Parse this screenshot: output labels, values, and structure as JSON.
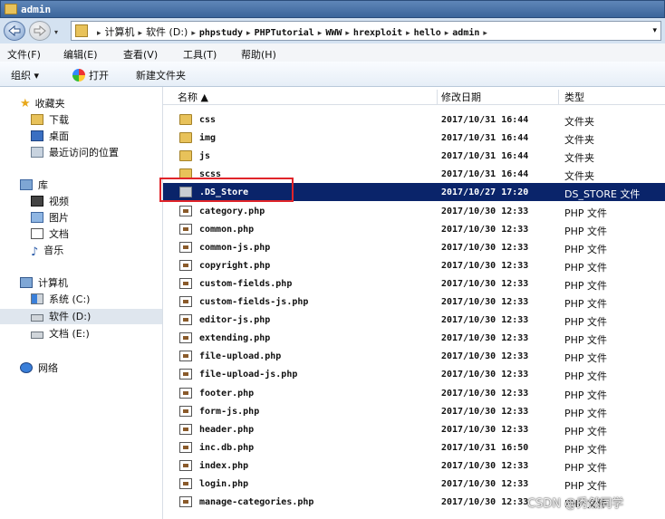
{
  "window": {
    "title": "admin"
  },
  "address": {
    "crumbs": [
      "计算机",
      "软件 (D:)",
      "phpstudy",
      "PHPTutorial",
      "WWW",
      "hrexploit",
      "hello",
      "admin"
    ]
  },
  "menu": [
    "文件(F)",
    "编辑(E)",
    "查看(V)",
    "工具(T)",
    "帮助(H)"
  ],
  "toolbar": {
    "organize": "组织 ▾",
    "open": "打开",
    "new_folder": "新建文件夹"
  },
  "nav": {
    "favorites": {
      "label": "收藏夹",
      "items": [
        "下载",
        "桌面",
        "最近访问的位置"
      ]
    },
    "libraries": {
      "label": "库",
      "items": [
        "视频",
        "图片",
        "文档",
        "音乐"
      ]
    },
    "computer": {
      "label": "计算机",
      "items": [
        "系统 (C:)",
        "软件 (D:)",
        "文档 (E:)"
      ]
    },
    "network": {
      "label": "网络"
    }
  },
  "columns": {
    "name": "名称 ▲",
    "date": "修改日期",
    "type": "类型"
  },
  "files": [
    {
      "name": "css",
      "date": "2017/10/31 16:44",
      "type": "文件夹",
      "icon": "folder"
    },
    {
      "name": "img",
      "date": "2017/10/31 16:44",
      "type": "文件夹",
      "icon": "folder"
    },
    {
      "name": "js",
      "date": "2017/10/31 16:44",
      "type": "文件夹",
      "icon": "folder"
    },
    {
      "name": "scss",
      "date": "2017/10/31 16:44",
      "type": "文件夹",
      "icon": "folder"
    },
    {
      "name": ".DS_Store",
      "date": "2017/10/27 17:20",
      "type": "DS_STORE 文件",
      "icon": "generic",
      "selected": true
    },
    {
      "name": "category.php",
      "date": "2017/10/30 12:33",
      "type": "PHP 文件",
      "icon": "php"
    },
    {
      "name": "common.php",
      "date": "2017/10/30 12:33",
      "type": "PHP 文件",
      "icon": "php"
    },
    {
      "name": "common-js.php",
      "date": "2017/10/30 12:33",
      "type": "PHP 文件",
      "icon": "php"
    },
    {
      "name": "copyright.php",
      "date": "2017/10/30 12:33",
      "type": "PHP 文件",
      "icon": "php"
    },
    {
      "name": "custom-fields.php",
      "date": "2017/10/30 12:33",
      "type": "PHP 文件",
      "icon": "php"
    },
    {
      "name": "custom-fields-js.php",
      "date": "2017/10/30 12:33",
      "type": "PHP 文件",
      "icon": "php"
    },
    {
      "name": "editor-js.php",
      "date": "2017/10/30 12:33",
      "type": "PHP 文件",
      "icon": "php"
    },
    {
      "name": "extending.php",
      "date": "2017/10/30 12:33",
      "type": "PHP 文件",
      "icon": "php"
    },
    {
      "name": "file-upload.php",
      "date": "2017/10/30 12:33",
      "type": "PHP 文件",
      "icon": "php"
    },
    {
      "name": "file-upload-js.php",
      "date": "2017/10/30 12:33",
      "type": "PHP 文件",
      "icon": "php"
    },
    {
      "name": "footer.php",
      "date": "2017/10/30 12:33",
      "type": "PHP 文件",
      "icon": "php"
    },
    {
      "name": "form-js.php",
      "date": "2017/10/30 12:33",
      "type": "PHP 文件",
      "icon": "php"
    },
    {
      "name": "header.php",
      "date": "2017/10/30 12:33",
      "type": "PHP 文件",
      "icon": "php"
    },
    {
      "name": "inc.db.php",
      "date": "2017/10/31 16:50",
      "type": "PHP 文件",
      "icon": "php"
    },
    {
      "name": "index.php",
      "date": "2017/10/30 12:33",
      "type": "PHP 文件",
      "icon": "php"
    },
    {
      "name": "login.php",
      "date": "2017/10/30 12:33",
      "type": "PHP 文件",
      "icon": "php"
    },
    {
      "name": "manage-categories.php",
      "date": "2017/10/30 12:33",
      "type": "PHP 文件",
      "icon": "php"
    }
  ],
  "watermark": "CSDN @秀然同学"
}
